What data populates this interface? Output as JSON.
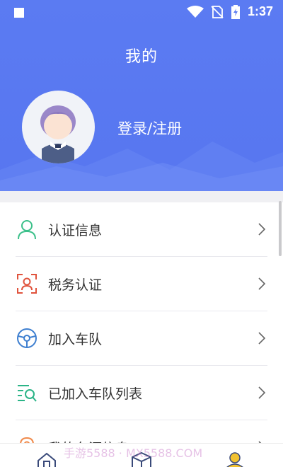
{
  "status_bar": {
    "time": "1:37"
  },
  "header": {
    "title": "我的",
    "login_label": "登录/注册"
  },
  "menu": {
    "items": [
      {
        "label": "认证信息",
        "icon": "user-verify-icon",
        "color": "#3cc08a"
      },
      {
        "label": "税务认证",
        "icon": "face-scan-icon",
        "color": "#e0533d"
      },
      {
        "label": "加入车队",
        "icon": "steering-wheel-icon",
        "color": "#3e7fd0"
      },
      {
        "label": "已加入车队列表",
        "icon": "list-search-icon",
        "color": "#2bb487"
      },
      {
        "label": "我的车源信息",
        "icon": "location-icon",
        "color": "#f08a4b"
      }
    ]
  },
  "watermark": "手游5588 · MX5588.COM",
  "colors": {
    "header_bg": "#5b7bf2",
    "text": "#333333",
    "divider": "#e9e9ee"
  }
}
